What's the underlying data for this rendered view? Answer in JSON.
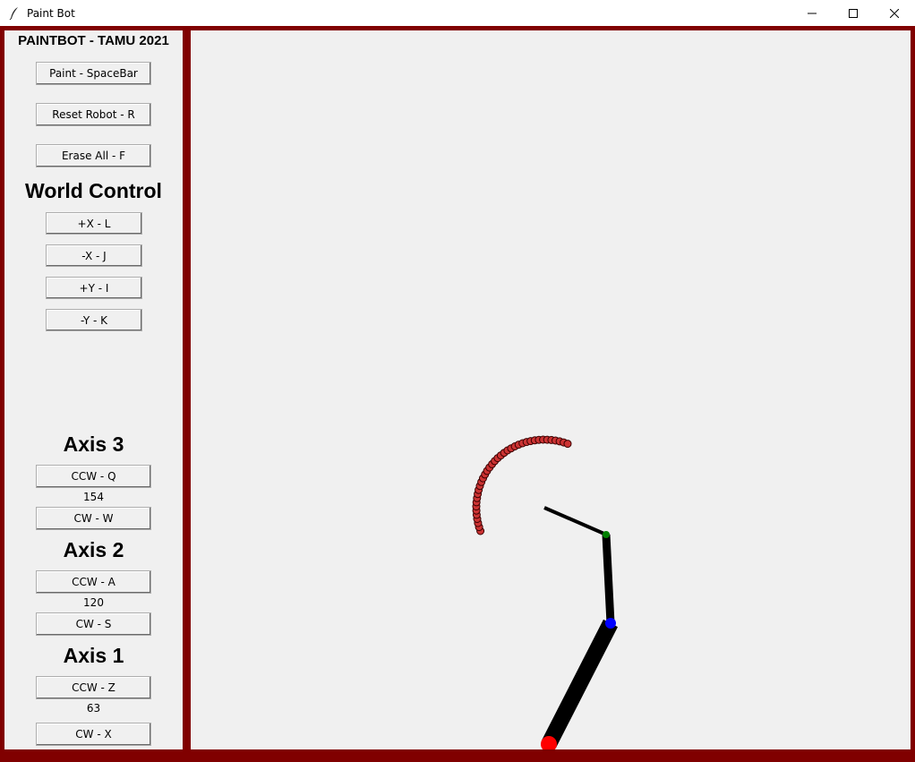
{
  "window": {
    "title": "Paint Bot"
  },
  "sidebar": {
    "heading": "PAINTBOT - TAMU 2021",
    "paint_label": "Paint - SpaceBar",
    "reset_label": "Reset Robot - R",
    "erase_label": "Erase All - F",
    "world_control": {
      "heading": "World Control",
      "plus_x": "+X - L",
      "minus_x": "-X - J",
      "plus_y": "+Y - I",
      "minus_y": "-Y - K"
    },
    "axis3": {
      "heading": "Axis 3",
      "ccw": "CCW - Q",
      "value": "154",
      "cw": "CW - W"
    },
    "axis2": {
      "heading": "Axis 2",
      "ccw": "CCW - A",
      "value": "120",
      "cw": "CW - S"
    },
    "axis1": {
      "heading": "Axis 1",
      "ccw": "CCW - Z",
      "value": "63",
      "cw": "CW - X"
    }
  },
  "colors": {
    "frame": "#800000",
    "arm": "#000000",
    "base_joint": "#ff0000",
    "mid_joint": "#0000ff",
    "end_joint": "#008000",
    "paint": "#cc3333"
  }
}
